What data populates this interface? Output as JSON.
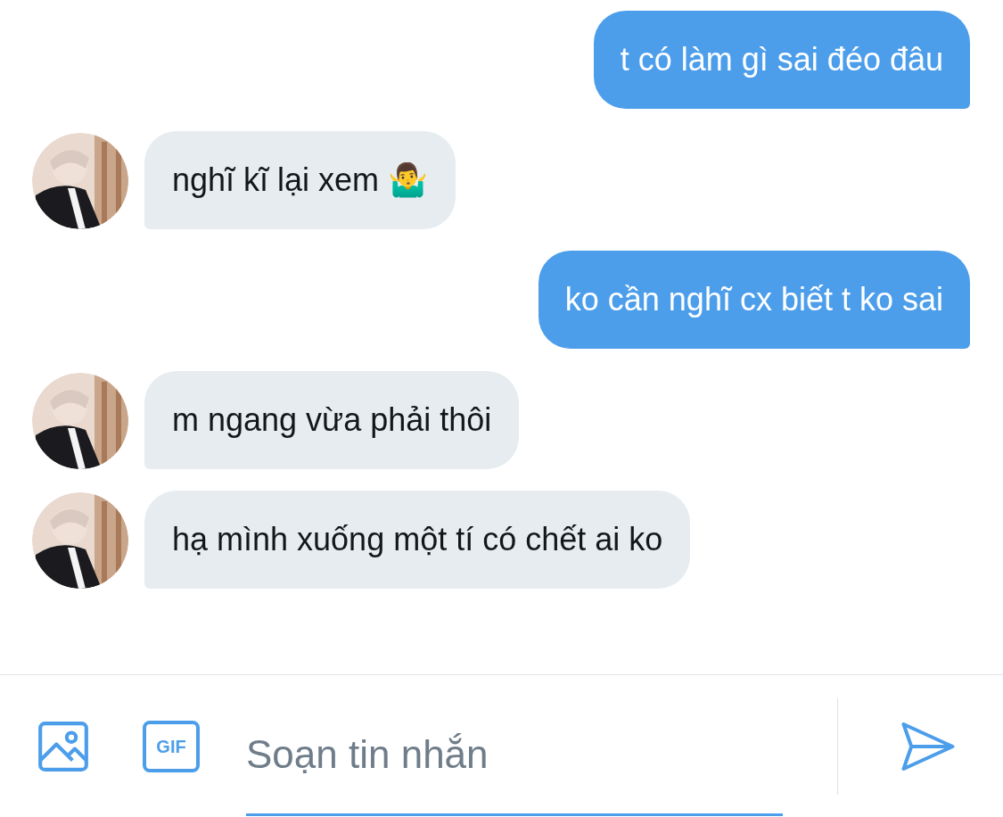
{
  "messages": [
    {
      "kind": "sent",
      "text": "t có làm gì sai đéo đâu"
    },
    {
      "kind": "received",
      "text": "nghĩ kĩ lại xem 🤷‍♂️"
    },
    {
      "kind": "sent",
      "text": "ko cần nghĩ cx biết t ko sai"
    },
    {
      "kind": "received",
      "text": "m ngang vừa phải thôi"
    },
    {
      "kind": "received",
      "text": "hạ mình xuống một tí có chết ai ko"
    }
  ],
  "composer": {
    "gif_label": "GIF",
    "placeholder": "Soạn tin nhắn"
  }
}
